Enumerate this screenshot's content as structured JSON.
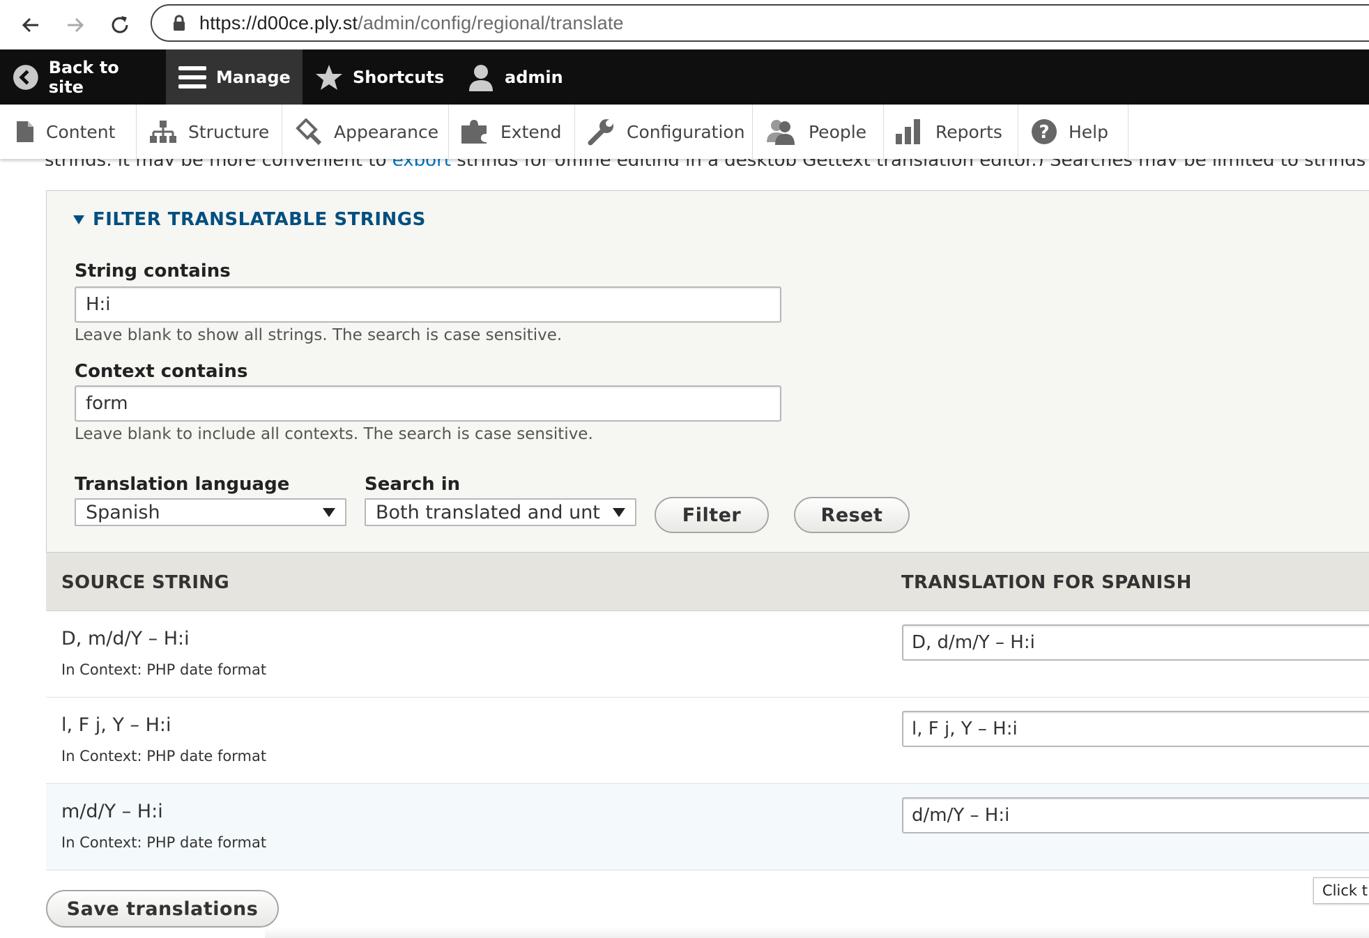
{
  "browser": {
    "url_host": "https://d00ce.ply.st",
    "url_path": "/admin/config/regional/translate"
  },
  "toolbar": {
    "back_to_site": "Back to site",
    "manage": "Manage",
    "shortcuts": "Shortcuts",
    "user": "admin"
  },
  "tray": {
    "items": [
      {
        "label": "Content",
        "icon": "file-icon"
      },
      {
        "label": "Structure",
        "icon": "sitemap-icon"
      },
      {
        "label": "Appearance",
        "icon": "paintbrush-icon"
      },
      {
        "label": "Extend",
        "icon": "puzzle-icon"
      },
      {
        "label": "Configuration",
        "icon": "wrench-icon"
      },
      {
        "label": "People",
        "icon": "people-icon"
      },
      {
        "label": "Reports",
        "icon": "bar-chart-icon"
      },
      {
        "label": "Help",
        "icon": "help-icon"
      }
    ]
  },
  "intro": {
    "before_link": "strings, it may be more convenient to ",
    "link": "export",
    "after_link": " strings for offline editing in a desktop Gettext translation editor.) Searches may be limited to strings in a"
  },
  "filter": {
    "legend": "FILTER TRANSLATABLE STRINGS",
    "string_label": "String contains",
    "string_value": "H:i",
    "string_desc": "Leave blank to show all strings. The search is case sensitive.",
    "context_label": "Context contains",
    "context_value": "form",
    "context_desc": "Leave blank to include all contexts. The search is case sensitive.",
    "language_label": "Translation language",
    "language_value": "Spanish",
    "search_in_label": "Search in",
    "search_in_value": "Both translated and untr",
    "filter_button": "Filter",
    "reset_button": "Reset"
  },
  "table": {
    "col_source": "SOURCE STRING",
    "col_translation": "TRANSLATION FOR SPANISH",
    "rows": [
      {
        "source": "D, m/d/Y – H:i",
        "context": "In Context: PHP date format",
        "translation": "D, d/m/Y – H:i"
      },
      {
        "source": "l, F j, Y – H:i",
        "context": "In Context: PHP date format",
        "translation": "l, F j, Y – H:i"
      },
      {
        "source": "m/d/Y – H:i",
        "context": "In Context: PHP date format",
        "translation": "d/m/Y – H:i"
      }
    ]
  },
  "save_button": "Save translations",
  "tooltip": "Click t"
}
